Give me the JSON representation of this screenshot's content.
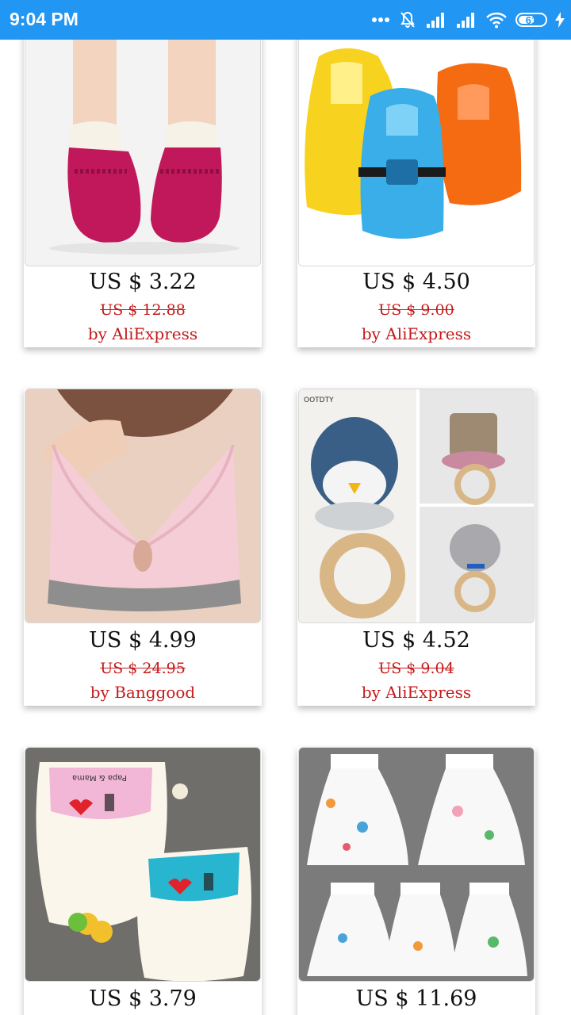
{
  "status_bar": {
    "time": "9:04 PM",
    "battery": "61"
  },
  "products": [
    {
      "price": "US $ 3.22",
      "old_price": "US $ 12.88",
      "vendor": "by AliExpress",
      "image": "baby-moccasin-shoes"
    },
    {
      "price": "US $ 4.50",
      "old_price": "US $ 9.00",
      "vendor": "by AliExpress",
      "image": "inflatable-swim-vests"
    },
    {
      "price": "US $ 4.99",
      "old_price": "US $ 24.95",
      "vendor": "by Banggood",
      "image": "pink-nursing-bra"
    },
    {
      "price": "US $ 4.52",
      "old_price": "US $ 9.04",
      "vendor": "by AliExpress",
      "image": "crochet-rattle-rings",
      "image_text": "OOTDTY"
    },
    {
      "price": "US $ 3.79",
      "image": "baby-sweat-towels",
      "image_text": "Papa & Mama"
    },
    {
      "price": "US $ 11.69",
      "image": "baby-diaper-skirts"
    }
  ]
}
